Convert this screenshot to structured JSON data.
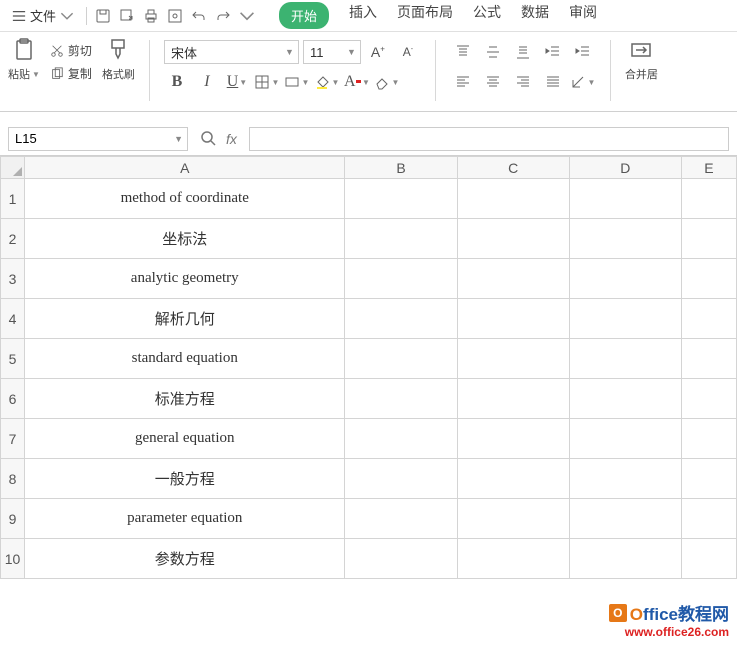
{
  "menu": {
    "file": "文件",
    "tabs": [
      "开始",
      "插入",
      "页面布局",
      "公式",
      "数据",
      "审阅"
    ]
  },
  "clipboard": {
    "paste": "粘贴",
    "cut": "剪切",
    "copy": "复制",
    "format_painter": "格式刷"
  },
  "font": {
    "name": "宋体",
    "size": "11"
  },
  "merge": {
    "label": "合并居"
  },
  "namebox": "L15",
  "columns": [
    "A",
    "B",
    "C",
    "D",
    "E"
  ],
  "rows": [
    "1",
    "2",
    "3",
    "4",
    "5",
    "6",
    "7",
    "8",
    "9",
    "10"
  ],
  "cells": {
    "A": [
      "method of coordinate",
      "坐标法",
      "analytic geometry",
      "解析几何",
      "standard equation",
      "标准方程",
      "general equation",
      "一般方程",
      "parameter  equation",
      "参数方程"
    ]
  },
  "watermark": {
    "brand": "Office教程网",
    "url": "www.office26.com"
  }
}
